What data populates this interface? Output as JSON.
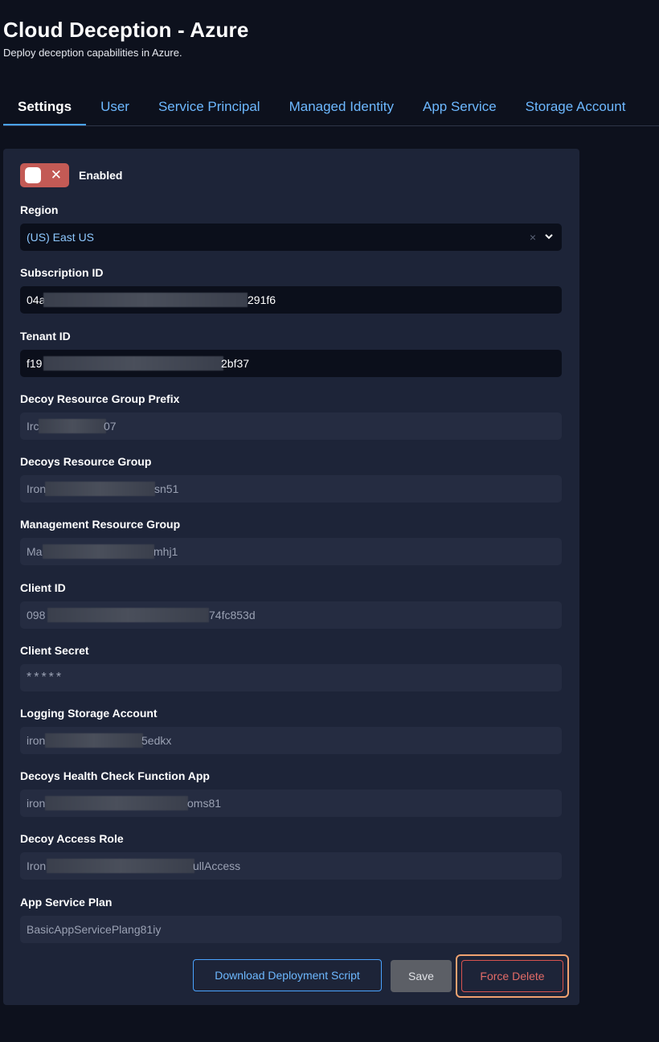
{
  "header": {
    "title": "Cloud Deception - Azure",
    "subtitle": "Deploy deception capabilities in Azure."
  },
  "tabs": [
    {
      "label": "Settings",
      "active": true
    },
    {
      "label": "User",
      "active": false
    },
    {
      "label": "Service Principal",
      "active": false
    },
    {
      "label": "Managed Identity",
      "active": false
    },
    {
      "label": "App Service",
      "active": false
    },
    {
      "label": "Storage Account",
      "active": false
    }
  ],
  "toggle": {
    "label": "Enabled",
    "state_icon": "close-icon",
    "color": "#c35a55"
  },
  "region": {
    "label": "Region",
    "value": "(US) East US",
    "clear_glyph": "×",
    "chevron": "chevron-down-icon"
  },
  "fields": {
    "subscription_id": {
      "label": "Subscription ID",
      "value_start": "04a",
      "value_end": "291f6"
    },
    "tenant_id": {
      "label": "Tenant ID",
      "value_start": "f19",
      "value_end": "2bf37"
    },
    "decoy_rg_prefix": {
      "label": "Decoy Resource Group Prefix",
      "value_start": "Irc",
      "value_end": "07"
    },
    "decoys_rg": {
      "label": "Decoys Resource Group",
      "value_start": "Iron",
      "value_end": "sn51"
    },
    "management_rg": {
      "label": "Management Resource Group",
      "value_start": "Ma",
      "value_end": "mhj1"
    },
    "client_id": {
      "label": "Client ID",
      "value_start": "098",
      "value_end": "74fc853d"
    },
    "client_secret": {
      "label": "Client Secret",
      "value": "*****"
    },
    "logging_storage": {
      "label": "Logging Storage Account",
      "value_start": "iron",
      "value_end": "5edkx"
    },
    "health_check_app": {
      "label": "Decoys Health Check Function App",
      "value_start": "iron",
      "value_end": "oms81"
    },
    "decoy_access_role": {
      "label": "Decoy Access Role",
      "value_start": "Iron",
      "value_end": "ullAccess"
    },
    "app_service_plan": {
      "label": "App Service Plan",
      "value": "BasicAppServicePlang81iy"
    }
  },
  "actions": {
    "download_label": "Download Deployment Script",
    "save_label": "Save",
    "force_delete_label": "Force Delete"
  },
  "colors": {
    "background": "#0d111d",
    "panel": "#1d2438",
    "accent": "#4aa3ff",
    "danger": "#d9534f",
    "focus_ring": "#f0a270"
  }
}
